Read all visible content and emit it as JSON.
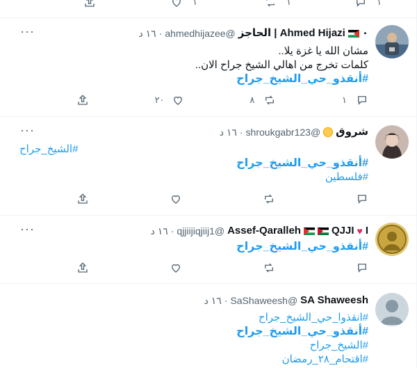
{
  "top_actions": {
    "reply_count": "",
    "retweet_count": "١",
    "like_count": "١"
  },
  "tweets": [
    {
      "name": "Ahmed Hijazi | الحاجز",
      "name_prefix": "٠",
      "handle": "@ahmedhijazee",
      "time": "١٦ د",
      "lines": [
        "مشان الله يا غزة يلا..",
        "كلمات تخرج من اهالي الشيخ جراح الان.."
      ],
      "hashtags": [
        "#أنقذو_حي_الشيخ_جراح"
      ],
      "reply_count": "١",
      "retweet_count": "٨",
      "like_count": "٢٠"
    },
    {
      "name": "شروق",
      "handle": "@shroukgabr123",
      "time": "١٦ د",
      "hashtags": [
        "#الشيخ_جراح",
        "#أنقذو_حي_الشيخ_جراح",
        "#فلسطين"
      ],
      "reply_count": "",
      "retweet_count": "",
      "like_count": ""
    },
    {
      "name": "Assef-Qaralleh",
      "name_suffix": "QJJI",
      "name_suffix2": "I",
      "handle": "@qjjiijiqjiij1",
      "time": "١٦ د",
      "hashtags": [
        "#أنقذو_حي_الشيخ_جراح"
      ],
      "reply_count": "",
      "retweet_count": "",
      "like_count": ""
    },
    {
      "name": "SA Shaweesh",
      "handle": "@SaShaweesh",
      "time": "١٦ د",
      "hashtags": [
        "#انقذوا_حي_الشيخ_جراح",
        "#أنقذو_حي_الشيخ_جراح",
        "#الشيخ_جراح",
        "#اقتحام_٢٨_رمضان"
      ]
    }
  ],
  "icons": {
    "reply": "reply-icon",
    "retweet": "retweet-icon",
    "like": "heart-icon",
    "share": "share-icon",
    "more": "more-icon"
  },
  "colors": {
    "link": "#1d9bf0",
    "muted": "#536471",
    "border": "#eff3f4"
  }
}
